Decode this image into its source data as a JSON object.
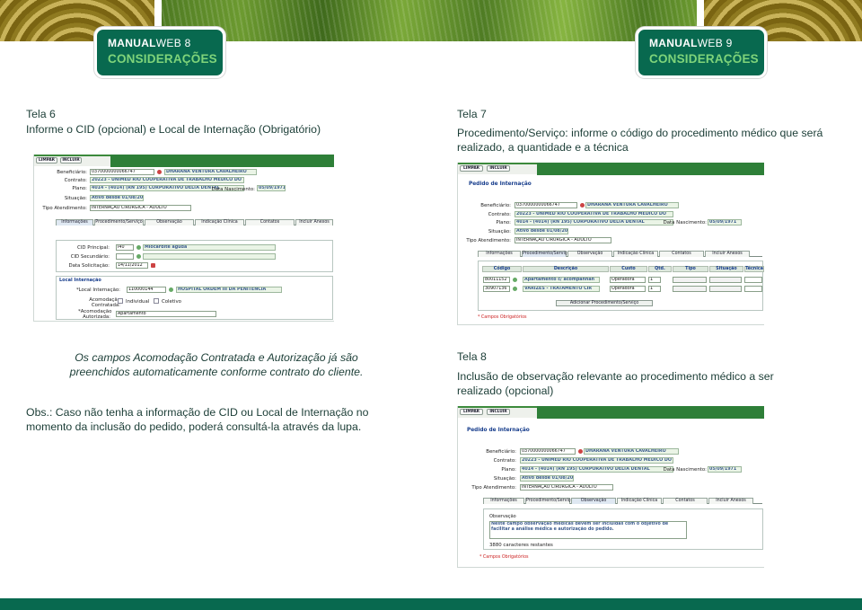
{
  "header": {
    "left": {
      "brand": "MANUAL",
      "brand_suffix": "WEB",
      "page": "8",
      "section": "CONSIDERAÇÕES"
    },
    "right": {
      "brand": "MANUAL",
      "brand_suffix": "WEB",
      "page": "9",
      "section": "CONSIDERAÇÕES"
    }
  },
  "tela6": {
    "heading": "Tela 6",
    "desc": "Informe o CID (opcional) e Local de Internação (Obrigatório)",
    "note": "Os campos Acomodação Contratada e Autorização já são preenchidos automaticamente conforme contrato do cliente.",
    "obs": "Obs.: Caso não tenha a informação de CID ou Local de Internação no momento da inclusão do pedido, poderá consultá-la através da lupa."
  },
  "tela7": {
    "heading": "Tela 7",
    "desc": "Procedimento/Serviço: informe o código do procedimento médico que será realizado, a quantidade e a técnica"
  },
  "tela8": {
    "heading": "Tela 8",
    "desc": "Inclusão de observação relevante ao procedimento médico a ser realizado (opcional)"
  },
  "form": {
    "btn_limpar": "LIMPAR",
    "btn_incluir": "INCLUIR",
    "title": "Pedido de Internação",
    "lbl_beneficiario": "Beneficiário:",
    "beneficiario_code": "0370000000066747",
    "beneficiario_name": "DHARANA VENTURA CAVALHEIRO",
    "lbl_contrato": "Contrato:",
    "contrato": "20223 - UNIMED RIO COOPERATIVA DE TRABALHO MEDICO DO",
    "lbl_plano": "Plano:",
    "plano": "4014 - (4014) (RN 195) CORPORATIVO DELTA DENTAL",
    "lbl_nascimento": "Data Nascimento:",
    "nascimento": "05/09/1971",
    "lbl_situacao": "Situação:",
    "situacao": "Ativo desde 01/08/2010",
    "lbl_tipo": "Tipo Atendimento:",
    "tipo": "INTERNAÇÃO CIRÚRGICA - ADULTO",
    "tabs": [
      "Informações",
      "Procedimento/Serviço",
      "Observação",
      "Indicação Clínica",
      "Contatos",
      "Incluir Anexos"
    ],
    "lbl_cid_principal": "CID Principal:",
    "cid_principal": "I40",
    "cid_desc": "Miocardite aguda",
    "lbl_cid_secundario": "CID Secundário:",
    "lbl_data_solicitacao": "Data Solicitação:",
    "data_solicitacao": "14/11/2012",
    "local_internacao": "Local Internação",
    "lbl_local": "*Local Internação:",
    "local_code": "110000144",
    "local_name": "HOSPITAL ORDEM III DA PENITENCIA",
    "lbl_acomodacao": "Acomodação Contratada:",
    "opt_individual": "Individual",
    "opt_coletivo": "Coletivo",
    "lbl_acomodacao_aut": "*Acomodação Autorizada:",
    "acomodacao_aut": "Apartamento",
    "proc_headers": [
      "Código",
      "Descrição",
      "Custo",
      "Qtd.",
      "Tipo",
      "Situação",
      "Técnica"
    ],
    "proc_rows": [
      {
        "codigo": "80011152",
        "descricao": "Apartamento c/ acompanhan",
        "custo": "Operadora",
        "qtd": "1"
      },
      {
        "codigo": "30907136",
        "descricao": "VARIZES - TRATAMENTO CIR",
        "custo": "Operadora",
        "qtd": "1"
      }
    ],
    "btn_adicionar": "Adicionar Procedimento/Serviço",
    "campos_obrigatorios": "* Campos Obrigatórios",
    "obs_label": "Observação",
    "obs_text": "Neste campo observação médicas devem ser incluídas com o objetivo de facilitar a análise médica e autorização do pedido.",
    "obs_counter": "3880 caracteres restantes"
  }
}
